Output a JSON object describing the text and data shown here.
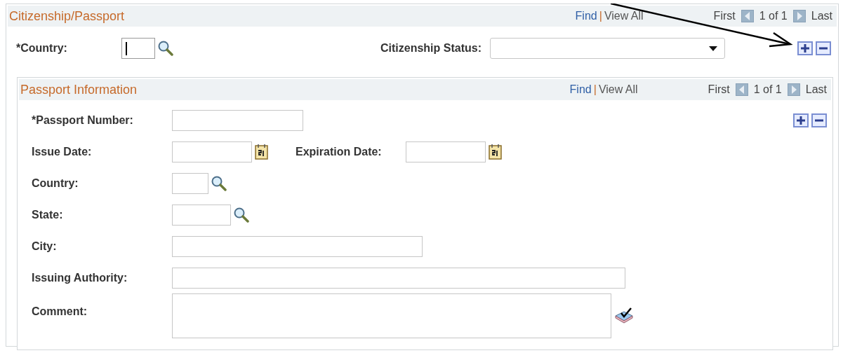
{
  "citizenship": {
    "title": "Citizenship/Passport",
    "nav": {
      "find": "Find",
      "separator": "|",
      "view_all": "View All",
      "first": "First",
      "counter": "1 of 1",
      "last": "Last"
    },
    "country": {
      "label": "*Country:",
      "focused": true
    },
    "status": {
      "label": "Citizenship Status:"
    },
    "passport": {
      "title": "Passport Information",
      "nav": {
        "find": "Find",
        "separator": "|",
        "view_all": "View All",
        "first": "First",
        "counter": "1 of 1",
        "last": "Last"
      },
      "fields": [
        {
          "label": "*Passport Number:",
          "kind": "text"
        },
        {
          "label": "Issue Date:",
          "kind": "date"
        },
        {
          "label": "Country:",
          "kind": "lookup"
        },
        {
          "label": "State:",
          "kind": "lookup"
        },
        {
          "label": "City:",
          "kind": "text"
        },
        {
          "label": "Issuing Authority:",
          "kind": "text"
        },
        {
          "label": "Comment:",
          "kind": "textarea"
        }
      ],
      "expiration": {
        "label": "Expiration Date:"
      }
    }
  }
}
